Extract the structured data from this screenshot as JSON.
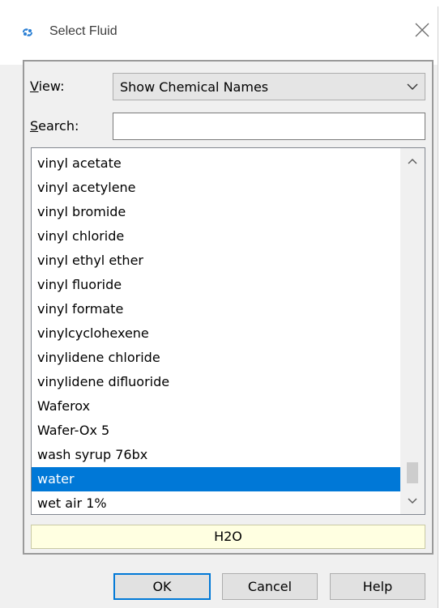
{
  "dialog": {
    "title": "Select Fluid",
    "title_icon": "app-icon",
    "close_icon": "close-icon"
  },
  "view": {
    "label_mnemonic": "V",
    "label_rest": "iew:",
    "selected": "Show Chemical Names"
  },
  "search": {
    "label_mnemonic": "S",
    "label_rest": "earch:",
    "value": ""
  },
  "fluid_list": {
    "items": [
      "vinyl acetate",
      "vinyl acetylene",
      "vinyl bromide",
      "vinyl chloride",
      "vinyl ethyl ether",
      "vinyl fluoride",
      "vinyl formate",
      "vinylcyclohexene",
      "vinylidene chloride",
      "vinylidene difluoride",
      "Waferox",
      "Wafer-Ox 5",
      "wash syrup 76bx",
      "water",
      "wet air 1%"
    ],
    "selected": "water"
  },
  "formula": "H2O",
  "buttons": {
    "ok": "OK",
    "cancel": "Cancel",
    "help": "Help"
  },
  "colors": {
    "selection": "#0078d7",
    "formula_bg": "#ffffe1"
  }
}
